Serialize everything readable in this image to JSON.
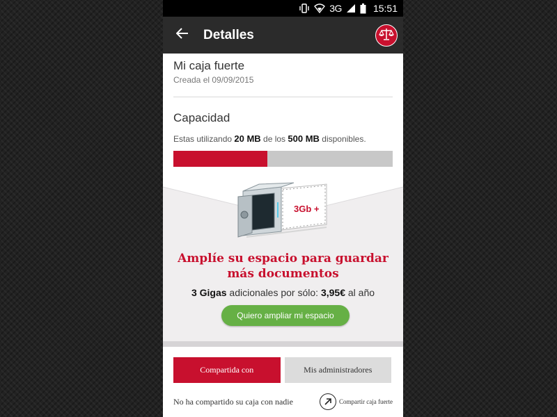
{
  "status_bar": {
    "network": "3G",
    "time": "15:51",
    "icons": [
      "vibrate-icon",
      "wifi-icon",
      "signal-icon",
      "battery-icon"
    ]
  },
  "app_bar": {
    "title": "Detalles",
    "back_icon": "arrow-left-icon",
    "logo_icon": "scales-of-justice-icon"
  },
  "safe": {
    "name": "Mi caja fuerte",
    "created": "Creada el 09/09/2015"
  },
  "capacity": {
    "title": "Capacidad",
    "text_prefix": "Estas utilizando",
    "used": "20 MB",
    "text_middle": "de los",
    "total": "500 MB",
    "text_suffix": "disponibles.",
    "used_fraction": 0.43
  },
  "promo": {
    "badge": "3Gb +",
    "title_line1": "Amplíe su espacio para guardar",
    "title_line2": "más documentos",
    "amount": "3 Gigas",
    "offer_middle": "adicionales por sólo:",
    "price": "3,95€",
    "offer_suffix": "al año",
    "cta_label": "Quiero ampliar mi espacio"
  },
  "tabs": [
    {
      "label": "Compartida con",
      "active": true
    },
    {
      "label": "Mis administradores",
      "active": false
    }
  ],
  "share": {
    "empty_text": "No ha compartido su caja con nadie",
    "action_label": "Compartir caja fuerte",
    "action_icon": "arrow-up-right-icon"
  },
  "colors": {
    "brand_red": "#c8102e",
    "cta_green": "#66b045",
    "app_bar": "#2b2b2b"
  }
}
